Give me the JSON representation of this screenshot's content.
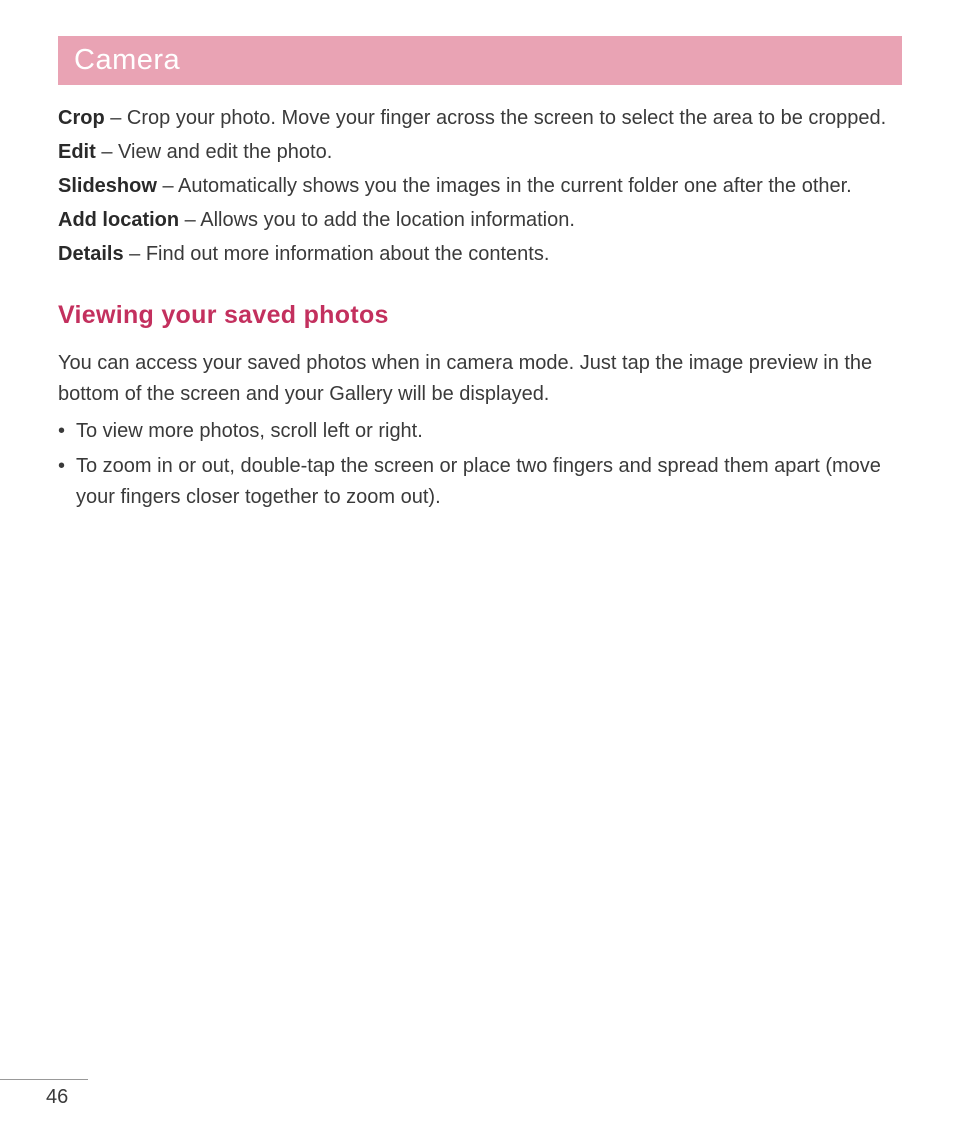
{
  "header": {
    "title": "Camera"
  },
  "options": [
    {
      "term": "Crop",
      "desc": " – Crop your photo. Move your finger across the screen to select the area to be cropped."
    },
    {
      "term": "Edit",
      "desc": " – View and edit the photo."
    },
    {
      "term": "Slideshow",
      "desc": " – Automatically shows you the images in the current folder one after the other."
    },
    {
      "term": "Add location",
      "desc": " – Allows you to add the location information."
    },
    {
      "term": "Details",
      "desc": " – Find out more information about the contents."
    }
  ],
  "section": {
    "subheading": "Viewing your saved photos",
    "intro": "You can access your saved photos when in camera mode. Just tap the image preview in the bottom of the screen and your Gallery will be displayed.",
    "bullets": [
      "To view more photos, scroll left or right.",
      "To zoom in or out, double-tap the screen or place two fingers and spread them apart (move your fingers closer together to zoom out)."
    ]
  },
  "pageNumber": "46"
}
